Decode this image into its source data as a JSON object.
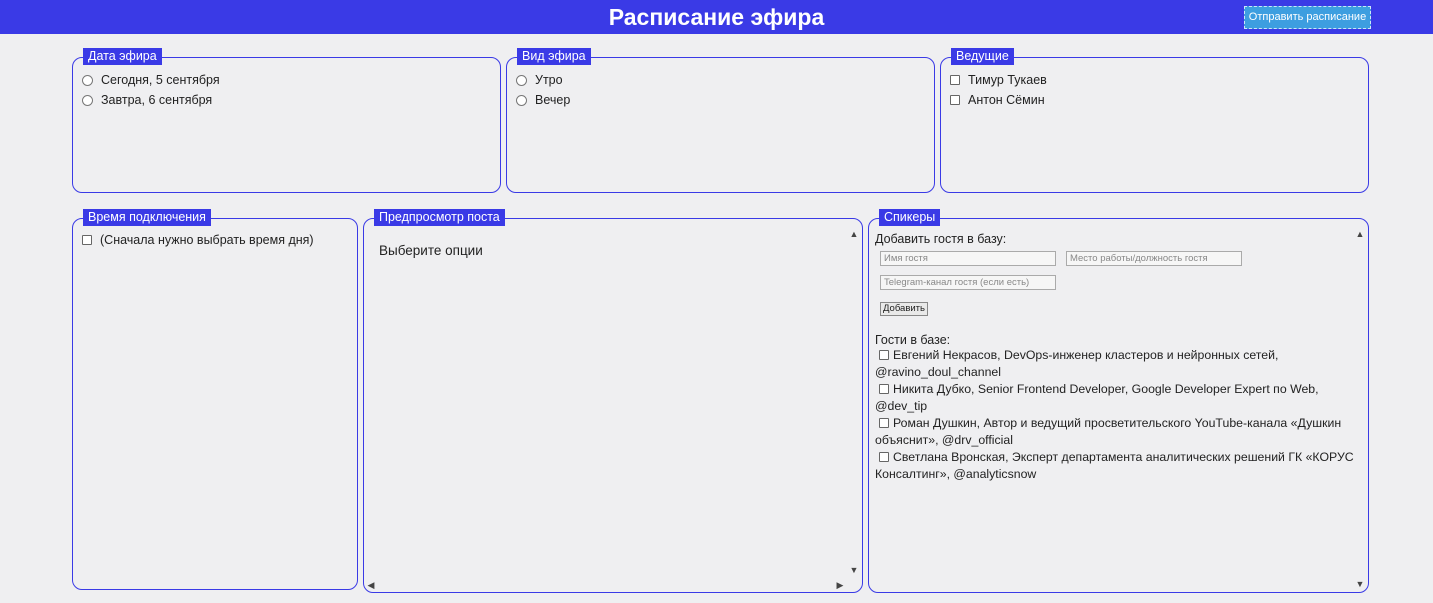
{
  "header": {
    "title": "Расписание эфира",
    "send_label": "Отправить расписание"
  },
  "date_panel": {
    "legend": "Дата эфира",
    "options": [
      "Сегодня, 5 сентября",
      "Завтра, 6 сентября"
    ]
  },
  "type_panel": {
    "legend": "Вид эфира",
    "options": [
      "Утро",
      "Вечер"
    ]
  },
  "hosts_panel": {
    "legend": "Ведущие",
    "options": [
      "Тимур Тукаев",
      "Антон Сёмин"
    ]
  },
  "time_panel": {
    "legend": "Время подключения",
    "options": [
      "(Сначала нужно выбрать время дня)"
    ]
  },
  "preview_panel": {
    "legend": "Предпросмотр поста",
    "text": "Выберите опции"
  },
  "speakers_panel": {
    "legend": "Спикеры",
    "add_label": "Добавить гостя в базу:",
    "name_placeholder": "Имя гостя",
    "job_placeholder": "Место работы/должность гостя",
    "telegram_placeholder": "Telegram-канал гостя (если есть)",
    "add_button": "Добавить",
    "guests_label": "Гости в базе:",
    "guests": [
      "Евгений Некрасов, DevOps-инженер кластеров и нейронных сетей, @ravino_doul_channel",
      "Никита Дубко, Senior Frontend Developer, Google Developer Expert по Web, @dev_tip",
      "Роман Душкин, Автор и ведущий просветительского YouTube-канала «Душкин объяснит», @drv_official",
      "Светлана Вронская, Эксперт департамента аналитических решений ГК «КОРУС Консалтинг», @analyticsnow"
    ]
  },
  "colors": {
    "accent": "#3a3ae6",
    "button": "#3d9ee0",
    "background": "#efeff1"
  }
}
